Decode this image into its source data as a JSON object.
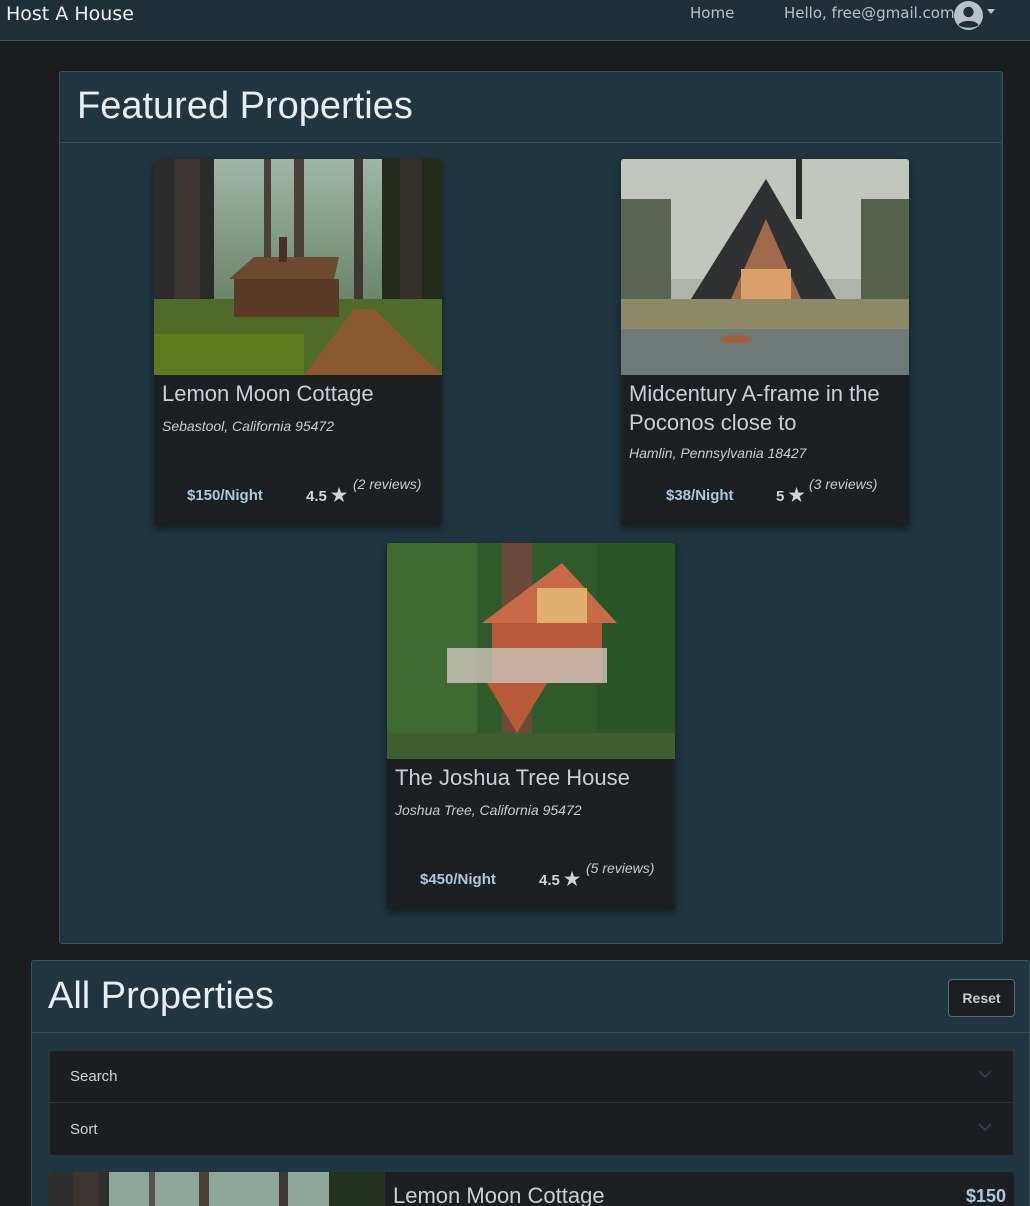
{
  "navbar": {
    "brand": "Host A House",
    "home": "Home",
    "user_greeting": "Hello, free@gmail.com",
    "avatar_icon": "user-circle-icon",
    "caret_icon": "caret-down-icon"
  },
  "featured": {
    "title": "Featured Properties",
    "cards": [
      {
        "title": "Lemon Moon Cottage",
        "location": "Sebastool, California 95472",
        "price": "$150/Night",
        "rating": "4.5",
        "reviews": "(2 reviews)",
        "image": "forest-cabin"
      },
      {
        "title": "Midcentury A-frame in the Poconos close to",
        "location": "Hamlin, Pennsylvania 18427",
        "price": "$38/Night",
        "rating": "5",
        "reviews": "(3 reviews)",
        "image": "a-frame-lakehouse"
      },
      {
        "title": "The Joshua Tree House",
        "location": "Joshua Tree, California 95472",
        "price": "$450/Night",
        "rating": "4.5",
        "reviews": "(5 reviews)",
        "image": "treehouse"
      }
    ],
    "star_icon": "star-icon"
  },
  "all_properties": {
    "title": "All Properties",
    "reset_label": "Reset",
    "accordion": [
      {
        "label": "Search"
      },
      {
        "label": "Sort"
      }
    ],
    "list": [
      {
        "title": "Lemon Moon Cottage",
        "price": "$150"
      }
    ]
  },
  "colors": {
    "page_bg": "#1a1c1e",
    "panel_bg": "#1f3540",
    "card_bg": "#1c1f22",
    "price_blue": "#a9c9dc"
  }
}
